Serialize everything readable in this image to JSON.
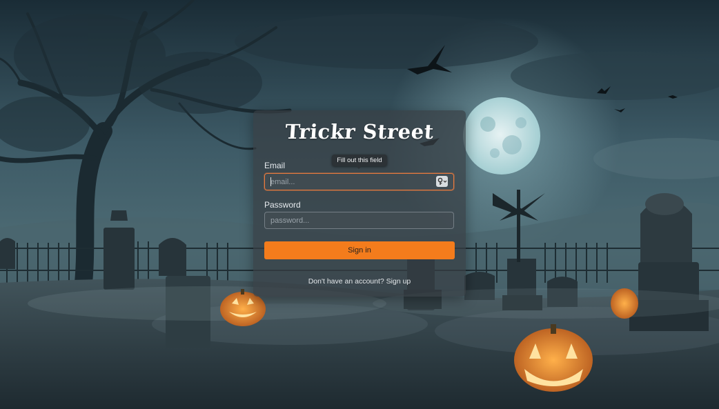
{
  "app": {
    "title": "Trickr Street"
  },
  "form": {
    "email_label": "Email",
    "email_placeholder": "email...",
    "email_value": "",
    "password_label": "Password",
    "password_placeholder": "password...",
    "password_value": "",
    "submit_label": "Sign in",
    "signup_prompt": "Don't have an account?",
    "signup_link": "Sign up"
  },
  "validation": {
    "tooltip": "Fill out this field"
  },
  "icons": {
    "password_manager": "key-icon",
    "background": "haunted-graveyard-scene"
  },
  "colors": {
    "accent": "#f47c1c",
    "focus_border": "#e87a3e",
    "card_background": "rgba(55, 62, 68, 0.72)"
  }
}
